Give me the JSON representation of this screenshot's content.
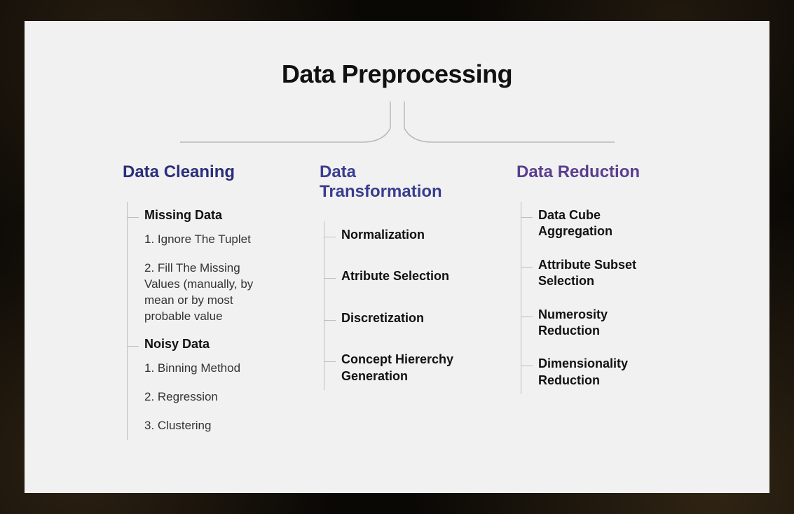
{
  "title": "Data Preprocessing",
  "columns": {
    "cleaning": {
      "title": "Data Cleaning",
      "missing": {
        "label": "Missing Data",
        "items": {
          "i1": "1. Ignore The Tuplet",
          "i2": "2. Fill The Missing Values (manually, by mean or by most probable value"
        }
      },
      "noisy": {
        "label": "Noisy Data",
        "items": {
          "i1": "1. Binning Method",
          "i2": "2. Regression",
          "i3": "3. Clustering"
        }
      }
    },
    "transformation": {
      "title": "Data Transformation",
      "items": {
        "i1": "Normalization",
        "i2": "Atribute Selection",
        "i3": "Discretization",
        "i4": "Concept Hiererchy Generation"
      }
    },
    "reduction": {
      "title": "Data Reduction",
      "items": {
        "i1": "Data Cube Aggregation",
        "i2": "Attribute Subset Selection",
        "i3": "Numerosity Reduction",
        "i4": "Dimensionality Reduction"
      }
    }
  }
}
